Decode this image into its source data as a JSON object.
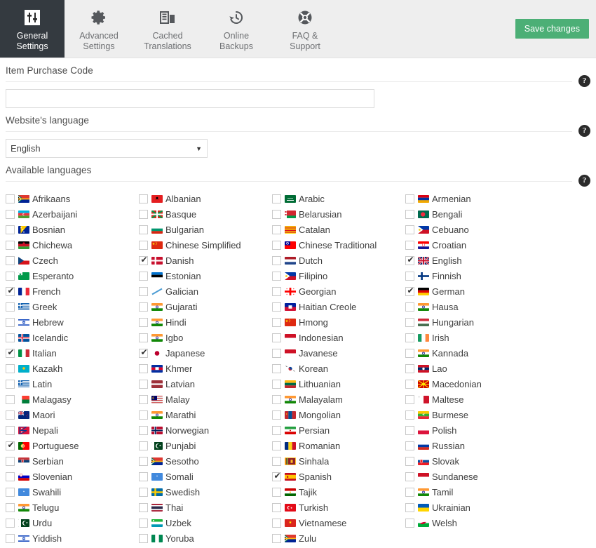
{
  "tabs": [
    {
      "label": "General\nSettings",
      "icon": "sliders-icon",
      "active": true
    },
    {
      "label": "Advanced\nSettings",
      "icon": "gear-icon",
      "active": false
    },
    {
      "label": "Cached\nTranslations",
      "icon": "database-icon",
      "active": false
    },
    {
      "label": "Online\nBackups",
      "icon": "history-clock-icon",
      "active": false
    },
    {
      "label": "FAQ &\nSupport",
      "icon": "lifebuoy-icon",
      "active": false
    }
  ],
  "toolbar": {
    "save_label": "Save changes",
    "save_color": "#4caf76"
  },
  "fields": {
    "purchase_code": {
      "label": "Item Purchase Code",
      "value": "",
      "placeholder": "",
      "help": "?"
    },
    "website_language": {
      "label": "Website's language",
      "value": "English",
      "help": "?"
    },
    "available_languages": {
      "label": "Available languages",
      "help": "?"
    }
  },
  "languages": [
    {
      "name": "Afrikaans",
      "checked": false,
      "flag": "za"
    },
    {
      "name": "Albanian",
      "checked": false,
      "flag": "al"
    },
    {
      "name": "Arabic",
      "checked": false,
      "flag": "sa"
    },
    {
      "name": "Armenian",
      "checked": false,
      "flag": "am"
    },
    {
      "name": "Azerbaijani",
      "checked": false,
      "flag": "az"
    },
    {
      "name": "Basque",
      "checked": false,
      "flag": "eu"
    },
    {
      "name": "Belarusian",
      "checked": false,
      "flag": "by"
    },
    {
      "name": "Bengali",
      "checked": false,
      "flag": "bd"
    },
    {
      "name": "Bosnian",
      "checked": false,
      "flag": "ba"
    },
    {
      "name": "Bulgarian",
      "checked": false,
      "flag": "bg"
    },
    {
      "name": "Catalan",
      "checked": false,
      "flag": "cat"
    },
    {
      "name": "Cebuano",
      "checked": false,
      "flag": "ph"
    },
    {
      "name": "Chichewa",
      "checked": false,
      "flag": "mw"
    },
    {
      "name": "Chinese Simplified",
      "checked": false,
      "flag": "cn"
    },
    {
      "name": "Chinese Traditional",
      "checked": false,
      "flag": "tw"
    },
    {
      "name": "Croatian",
      "checked": false,
      "flag": "hr"
    },
    {
      "name": "Czech",
      "checked": false,
      "flag": "cz"
    },
    {
      "name": "Danish",
      "checked": true,
      "flag": "dk"
    },
    {
      "name": "Dutch",
      "checked": false,
      "flag": "nl"
    },
    {
      "name": "English",
      "checked": true,
      "flag": "gb"
    },
    {
      "name": "Esperanto",
      "checked": false,
      "flag": "eo"
    },
    {
      "name": "Estonian",
      "checked": false,
      "flag": "ee"
    },
    {
      "name": "Filipino",
      "checked": false,
      "flag": "ph"
    },
    {
      "name": "Finnish",
      "checked": false,
      "flag": "fi"
    },
    {
      "name": "French",
      "checked": true,
      "flag": "fr"
    },
    {
      "name": "Galician",
      "checked": false,
      "flag": "gal"
    },
    {
      "name": "Georgian",
      "checked": false,
      "flag": "ge"
    },
    {
      "name": "German",
      "checked": true,
      "flag": "de"
    },
    {
      "name": "Greek",
      "checked": false,
      "flag": "gr"
    },
    {
      "name": "Gujarati",
      "checked": false,
      "flag": "in"
    },
    {
      "name": "Haitian Creole",
      "checked": false,
      "flag": "ht"
    },
    {
      "name": "Hausa",
      "checked": false,
      "flag": "in"
    },
    {
      "name": "Hebrew",
      "checked": false,
      "flag": "il"
    },
    {
      "name": "Hindi",
      "checked": false,
      "flag": "in"
    },
    {
      "name": "Hmong",
      "checked": false,
      "flag": "cn"
    },
    {
      "name": "Hungarian",
      "checked": false,
      "flag": "hu"
    },
    {
      "name": "Icelandic",
      "checked": false,
      "flag": "is"
    },
    {
      "name": "Igbo",
      "checked": false,
      "flag": "in"
    },
    {
      "name": "Indonesian",
      "checked": false,
      "flag": "id"
    },
    {
      "name": "Irish",
      "checked": false,
      "flag": "ie"
    },
    {
      "name": "Italian",
      "checked": true,
      "flag": "it"
    },
    {
      "name": "Japanese",
      "checked": true,
      "flag": "jp"
    },
    {
      "name": "Javanese",
      "checked": false,
      "flag": "id"
    },
    {
      "name": "Kannada",
      "checked": false,
      "flag": "in"
    },
    {
      "name": "Kazakh",
      "checked": false,
      "flag": "kz"
    },
    {
      "name": "Khmer",
      "checked": false,
      "flag": "kh"
    },
    {
      "name": "Korean",
      "checked": false,
      "flag": "kr"
    },
    {
      "name": "Lao",
      "checked": false,
      "flag": "la"
    },
    {
      "name": "Latin",
      "checked": false,
      "flag": "gr"
    },
    {
      "name": "Latvian",
      "checked": false,
      "flag": "lv"
    },
    {
      "name": "Lithuanian",
      "checked": false,
      "flag": "lt"
    },
    {
      "name": "Macedonian",
      "checked": false,
      "flag": "mk"
    },
    {
      "name": "Malagasy",
      "checked": false,
      "flag": "mg"
    },
    {
      "name": "Malay",
      "checked": false,
      "flag": "my"
    },
    {
      "name": "Malayalam",
      "checked": false,
      "flag": "in"
    },
    {
      "name": "Maltese",
      "checked": false,
      "flag": "mt"
    },
    {
      "name": "Maori",
      "checked": false,
      "flag": "nz"
    },
    {
      "name": "Marathi",
      "checked": false,
      "flag": "in"
    },
    {
      "name": "Mongolian",
      "checked": false,
      "flag": "mn"
    },
    {
      "name": "Burmese",
      "checked": false,
      "flag": "mm"
    },
    {
      "name": "Nepali",
      "checked": false,
      "flag": "np"
    },
    {
      "name": "Norwegian",
      "checked": false,
      "flag": "no"
    },
    {
      "name": "Persian",
      "checked": false,
      "flag": "ir"
    },
    {
      "name": "Polish",
      "checked": false,
      "flag": "pl"
    },
    {
      "name": "Portuguese",
      "checked": true,
      "flag": "pt"
    },
    {
      "name": "Punjabi",
      "checked": false,
      "flag": "pk"
    },
    {
      "name": "Romanian",
      "checked": false,
      "flag": "ro"
    },
    {
      "name": "Russian",
      "checked": false,
      "flag": "ru"
    },
    {
      "name": "Serbian",
      "checked": false,
      "flag": "rs"
    },
    {
      "name": "Sesotho",
      "checked": false,
      "flag": "za"
    },
    {
      "name": "Sinhala",
      "checked": false,
      "flag": "lk"
    },
    {
      "name": "Slovak",
      "checked": false,
      "flag": "sk"
    },
    {
      "name": "Slovenian",
      "checked": false,
      "flag": "si"
    },
    {
      "name": "Somali",
      "checked": false,
      "flag": "so"
    },
    {
      "name": "Spanish",
      "checked": true,
      "flag": "es"
    },
    {
      "name": "Sundanese",
      "checked": false,
      "flag": "id"
    },
    {
      "name": "Swahili",
      "checked": false,
      "flag": "so"
    },
    {
      "name": "Swedish",
      "checked": false,
      "flag": "se"
    },
    {
      "name": "Tajik",
      "checked": false,
      "flag": "tj"
    },
    {
      "name": "Tamil",
      "checked": false,
      "flag": "in"
    },
    {
      "name": "Telugu",
      "checked": false,
      "flag": "in"
    },
    {
      "name": "Thai",
      "checked": false,
      "flag": "th"
    },
    {
      "name": "Turkish",
      "checked": false,
      "flag": "tr"
    },
    {
      "name": "Ukrainian",
      "checked": false,
      "flag": "ua"
    },
    {
      "name": "Urdu",
      "checked": false,
      "flag": "pk"
    },
    {
      "name": "Uzbek",
      "checked": false,
      "flag": "uz"
    },
    {
      "name": "Vietnamese",
      "checked": false,
      "flag": "vn"
    },
    {
      "name": "Welsh",
      "checked": false,
      "flag": "wales"
    },
    {
      "name": "Yiddish",
      "checked": false,
      "flag": "il"
    },
    {
      "name": "Yoruba",
      "checked": false,
      "flag": "ng"
    },
    {
      "name": "Zulu",
      "checked": false,
      "flag": "za"
    }
  ]
}
